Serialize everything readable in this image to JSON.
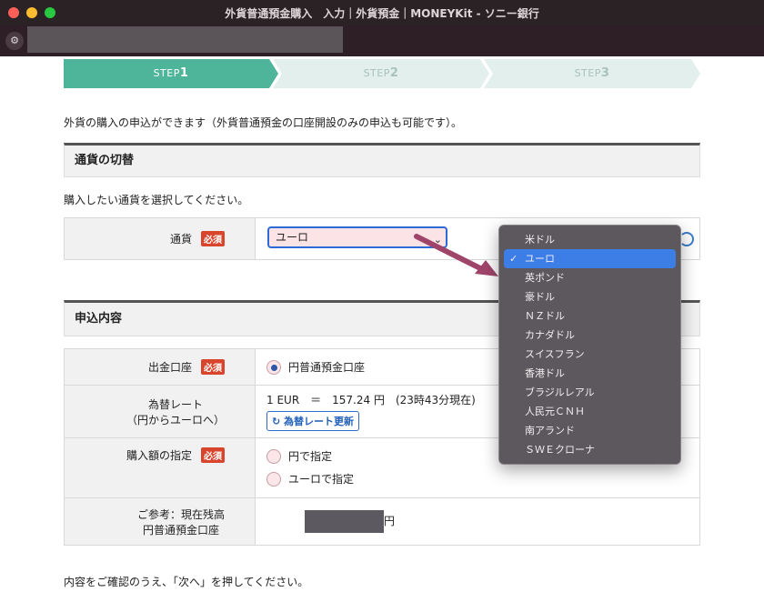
{
  "window": {
    "title": "外貨普通預金購入　入力｜外貨預金｜MONEYKit - ソニー銀行"
  },
  "steps": [
    {
      "prefix": "STEP",
      "num": "1"
    },
    {
      "prefix": "STEP",
      "num": "2"
    },
    {
      "prefix": "STEP",
      "num": "3"
    }
  ],
  "intro": "外貨の購入の申込ができます（外貨普通預金の口座開設のみの申込も可能です）。",
  "currency_section": {
    "title": "通貨の切替",
    "note": "購入したい通貨を選択してください。",
    "label": "通貨",
    "required": "必須",
    "selected": "ユーロ"
  },
  "application_section": {
    "title": "申込内容",
    "account_label": "出金口座",
    "required": "必須",
    "account_value": "円普通預金口座",
    "rate_label_1": "為替レート",
    "rate_label_2": "（円からユーロへ）",
    "rate_text": "1 EUR　＝　157.24 円　(23時43分現在)",
    "rate_button": "為替レート更新",
    "amount_label": "購入額の指定",
    "amount_opt1": "円で指定",
    "amount_opt2": "ユーロで指定",
    "balance_label_1": "ご参考：現在残高",
    "balance_label_2": "円普通預金口座",
    "balance_unit": "円"
  },
  "footer": "内容をご確認のうえ、「次へ」を押してください。",
  "dropdown": {
    "selected_index": 1,
    "items": [
      "米ドル",
      "ユーロ",
      "英ポンド",
      "豪ドル",
      "ＮＺドル",
      "カナダドル",
      "スイスフラン",
      "香港ドル",
      "ブラジルレアル",
      "人民元ＣＮＨ",
      "南アランド",
      "ＳＷＥクローナ"
    ]
  },
  "colors": {
    "step_active": "#4fb59a",
    "step_inactive": "#e2efec",
    "required_badge": "#d9452c",
    "dropdown_selected": "#3c7de6",
    "arrow": "#a0456a"
  }
}
